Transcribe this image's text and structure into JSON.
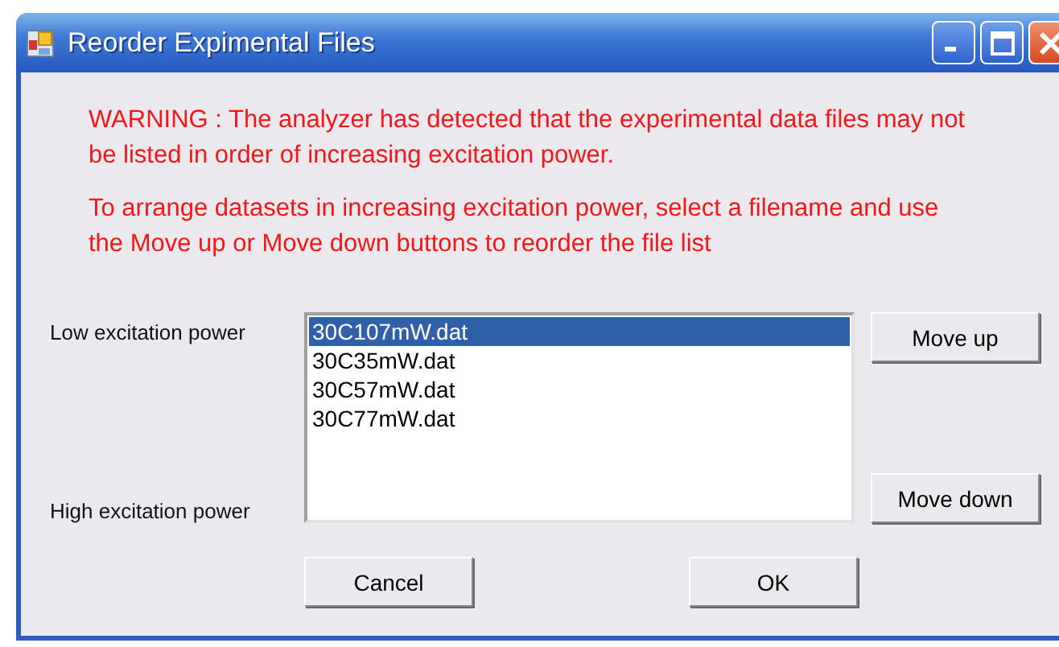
{
  "window": {
    "title": "Reorder Expimental Files"
  },
  "warning": [
    "WARNING : The analyzer has detected that the experimental data files may not be listed in order of increasing excitation power.",
    "To arrange datasets in increasing excitation power, select a filename and use the Move up or Move down buttons to reorder the file list"
  ],
  "labels": {
    "top": "Low excitation power",
    "bottom": "High excitation power"
  },
  "files": [
    {
      "name": "30C107mW.dat",
      "selected": true
    },
    {
      "name": "30C35mW.dat",
      "selected": false
    },
    {
      "name": "30C57mW.dat",
      "selected": false
    },
    {
      "name": "30C77mW.dat",
      "selected": false
    }
  ],
  "side_buttons": [
    "Move up",
    "Move down"
  ],
  "buttons": [
    "Cancel",
    "OK"
  ]
}
